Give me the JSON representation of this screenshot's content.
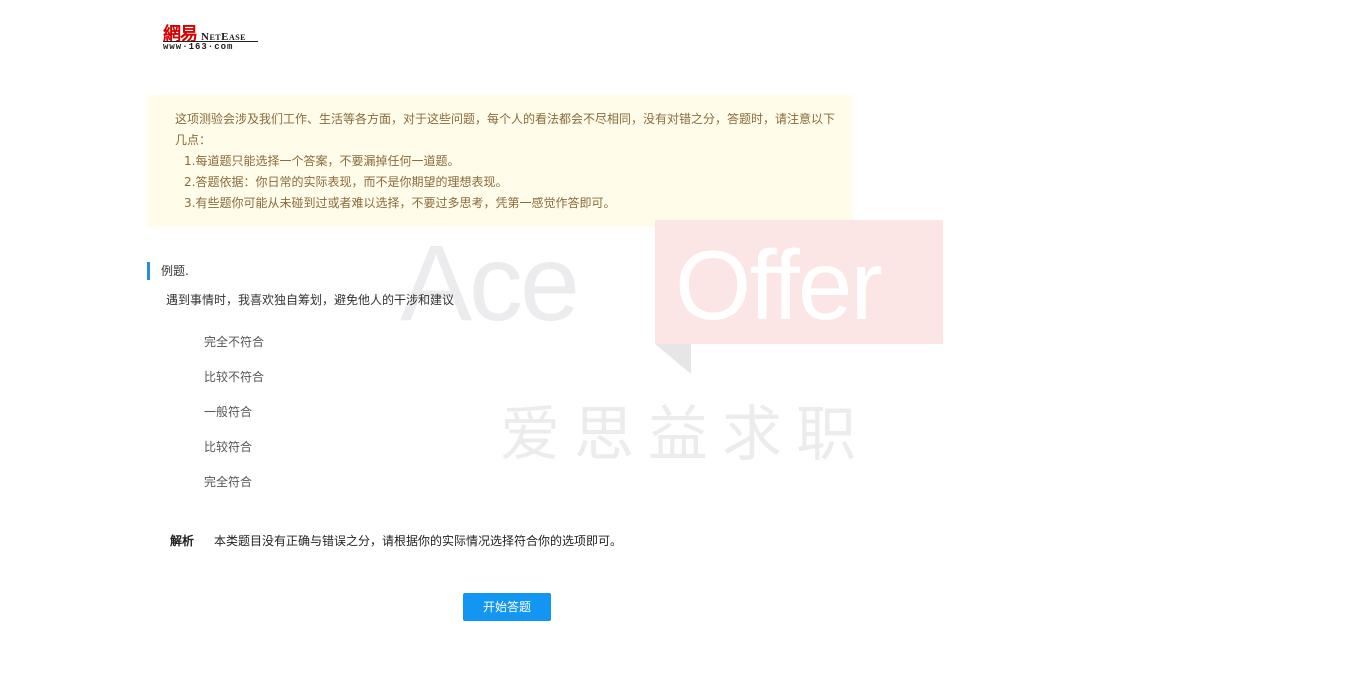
{
  "logo": {
    "cn": "網易",
    "en": "NetEase",
    "url": "www·163·com"
  },
  "notice": {
    "intro": "这项测验会涉及我们工作、生活等各方面，对于这些问题，每个人的看法都会不尽相同，没有对错之分，答题时，请注意以下几点：",
    "items": [
      "1.每道题只能选择一个答案，不要漏掉任何一道题。",
      "2.答题依据：你日常的实际表现，而不是你期望的理想表现。",
      "3.有些题你可能从未碰到过或者难以选择，不要过多思考，凭第一感觉作答即可。"
    ]
  },
  "watermark": {
    "ace": "Ace",
    "offer": "Offer",
    "cn": "爱思益求职"
  },
  "example": {
    "label": "例题.",
    "question": "遇到事情时，我喜欢独自筹划，避免他人的干涉和建议",
    "options": [
      "完全不符合",
      "比较不符合",
      "一般符合",
      "比较符合",
      "完全符合"
    ]
  },
  "analysis": {
    "label": "解析",
    "text": "本类题目没有正确与错误之分，请根据你的实际情况选择符合你的选项即可。"
  },
  "start_button": "开始答题",
  "colors": {
    "accent": "#1296f2",
    "notice_bg": "#fffdea",
    "notice_text": "#8a6a3a",
    "logo_red": "#d40000"
  }
}
